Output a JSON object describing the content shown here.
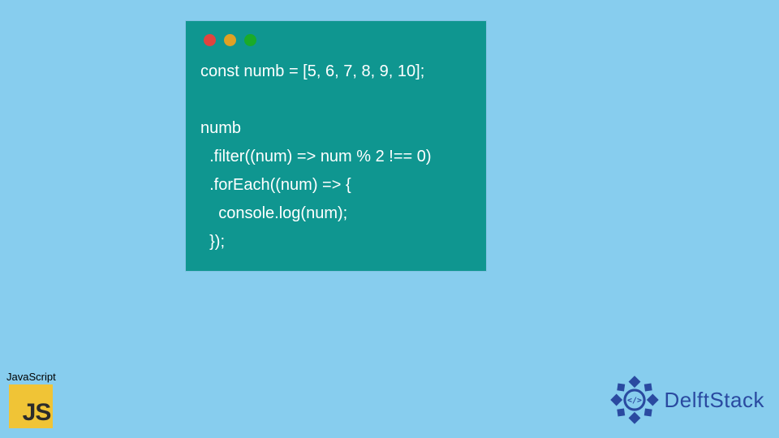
{
  "code": {
    "window_dots": [
      "red",
      "yellow",
      "green"
    ],
    "lines": [
      "const numb = [5, 6, 7, 8, 9, 10];",
      "",
      "numb",
      "  .filter((num) => num % 2 !== 0)",
      "  .forEach((num) => {",
      "    console.log(num);",
      "  });"
    ],
    "background_color": "#0f9690",
    "text_color": "#ffffff"
  },
  "js_badge": {
    "label": "JavaScript",
    "logo_text": "JS",
    "logo_bg": "#f0c436"
  },
  "brand": {
    "name": "DelftStack",
    "color": "#2a4aa0"
  },
  "page_bg": "#87cdee"
}
